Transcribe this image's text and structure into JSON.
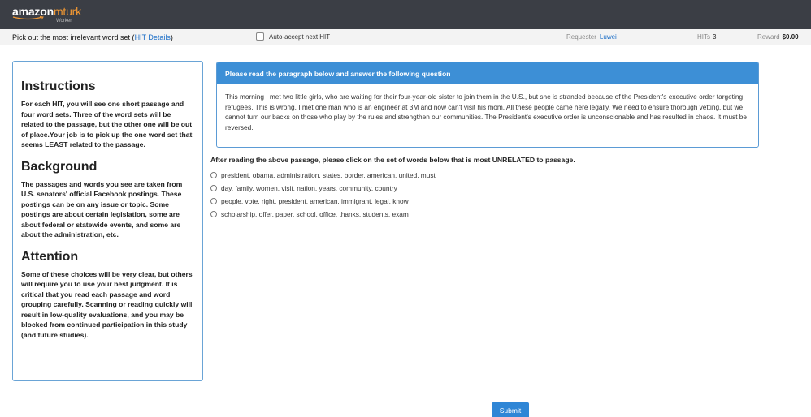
{
  "header": {
    "logo_main": "amazon",
    "logo_accent": "mturk",
    "logo_sub": "Worker"
  },
  "infobar": {
    "task_title": "Pick out the most irrelevant word set (",
    "details_link": "HIT Details",
    "task_title_end": ")",
    "auto_accept": "Auto-accept next HIT",
    "requester_label": "Requester",
    "requester_value": "Luwei",
    "hits_label": "HITs",
    "hits_value": "3",
    "reward_label": "Reward",
    "reward_value": "$0.00"
  },
  "instructions": {
    "h1": "Instructions",
    "p1": "For each HIT, you will see one short passage and four word sets. Three of the word sets will be related to the passage, but the other one will be out of place.Your job is to pick up the one word set that seems LEAST related to the passage.",
    "h2": "Background",
    "p2": "The passages and words you see are taken from U.S. senators' official Facebook postings. These postings can be on any issue or topic. Some postings are about certain legislation, some are about federal or statewide events, and some are about the administration, etc.",
    "h3": "Attention",
    "p3": "Some of these choices will be very clear, but others will require you to use your best judgment. It is critical that you read each passage and word grouping carefully. Scanning or reading quickly will result in low-quality evaluations, and you may be blocked from continued participation in this study (and future studies)."
  },
  "passage": {
    "header": "Please read the paragraph below and answer the following question",
    "text": "This morning I met two little girls, who are waiting for their four-year-old sister to join them in the U.S., but she is stranded because of the President's executive order targeting refugees. This is wrong. I met one man who is an engineer at 3M and now can't visit his mom. All these people came here legally. We need to ensure thorough vetting, but we cannot turn our backs on those who play by the rules and strengthen our communities. The President's executive order is unconscionable and has resulted in chaos. It must be reversed."
  },
  "question": "After reading the above passage, please click on the set of words below that is most UNRELATED to passage.",
  "options": [
    "president, obama, administration, states, border, american, united, must",
    "day, family, women, visit, nation, years, community, country",
    "people, vote, right, president, american, immigrant, legal, know",
    "scholarship, offer, paper, school, office, thanks, students, exam"
  ],
  "submit_label": "Submit"
}
